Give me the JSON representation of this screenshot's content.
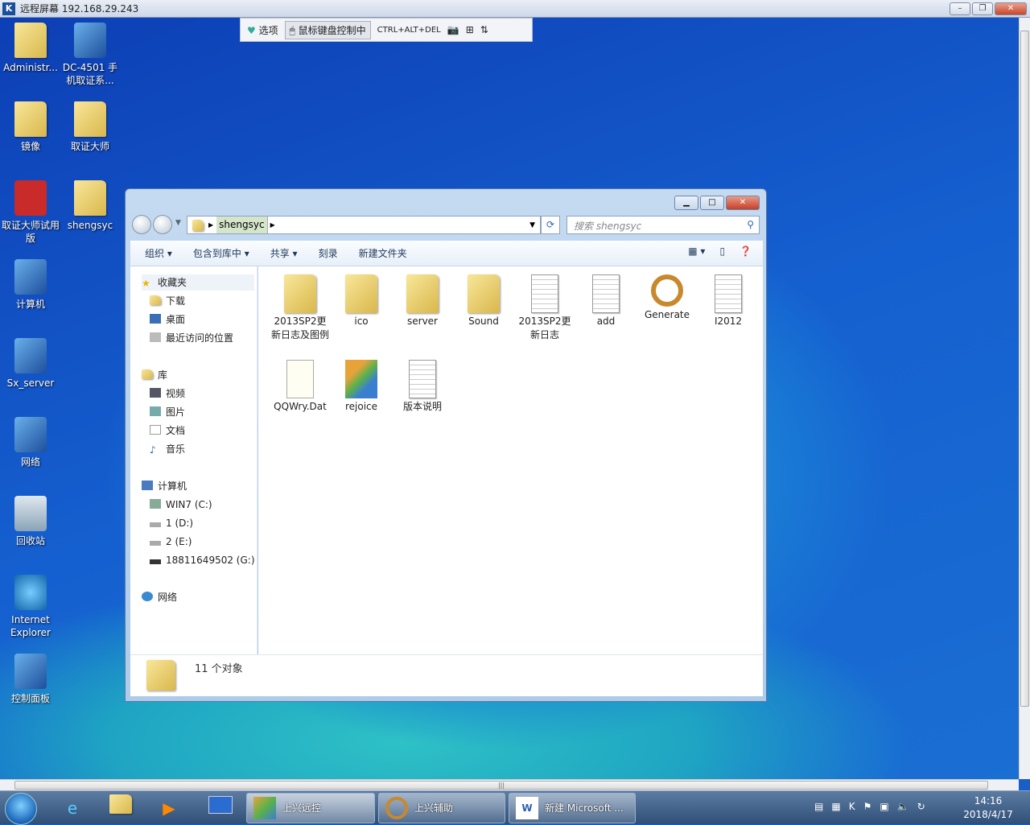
{
  "host": {
    "title": "远程屏幕 192.168.29.243"
  },
  "remote_toolbar": {
    "options": "选项",
    "control": "鼠标键盘控制中",
    "cad": "CTRL+ALT+DEL"
  },
  "desktop_icons": [
    {
      "label": "Administr...",
      "icon": "user-folder"
    },
    {
      "label": "DC-4501 手机取证系...",
      "icon": "app-shortcut"
    },
    {
      "label": "镜像",
      "icon": "folder"
    },
    {
      "label": "取证大师",
      "icon": "folder"
    },
    {
      "label": "取证大师试用版",
      "icon": "app-shortcut"
    },
    {
      "label": "shengsyc",
      "icon": "folder"
    },
    {
      "label": "计算机",
      "icon": "computer"
    },
    {
      "label": "Sx_server",
      "icon": "server"
    },
    {
      "label": "网络",
      "icon": "network"
    },
    {
      "label": "回收站",
      "icon": "recycle-bin"
    },
    {
      "label": "Internet Explorer",
      "icon": "ie"
    },
    {
      "label": "控制面板",
      "icon": "control-panel"
    }
  ],
  "explorer": {
    "address": "shengsyc",
    "search_placeholder": "搜索 shengsyc",
    "commands": [
      "组织",
      "包含到库中",
      "共享",
      "刻录",
      "新建文件夹"
    ],
    "sidebar": {
      "favorites": "收藏夹",
      "fav_items": [
        "下载",
        "桌面",
        "最近访问的位置"
      ],
      "libraries": "库",
      "lib_items": [
        "视频",
        "图片",
        "文档",
        "音乐"
      ],
      "computer": "计算机",
      "drives": [
        "WIN7 (C:)",
        "1 (D:)",
        "2 (E:)",
        "18811649502 (G:)"
      ],
      "network": "网络"
    },
    "files": [
      {
        "name": "2013SP2更新日志及图例",
        "type": "folder"
      },
      {
        "name": "ico",
        "type": "folder"
      },
      {
        "name": "server",
        "type": "folder"
      },
      {
        "name": "Sound",
        "type": "folder"
      },
      {
        "name": "2013SP2更新日志",
        "type": "document"
      },
      {
        "name": "add",
        "type": "document"
      },
      {
        "name": "Generate",
        "type": "rope-app"
      },
      {
        "name": "I2012",
        "type": "settings-file"
      },
      {
        "name": "QQWry.Dat",
        "type": "file"
      },
      {
        "name": "rejoice",
        "type": "app"
      },
      {
        "name": "版本说明",
        "type": "document"
      }
    ],
    "status": "11 个对象"
  },
  "taskbar": {
    "buttons": [
      "上兴远控",
      "上兴辅助",
      "新建 Microsoft ..."
    ],
    "time": "14:16",
    "date": "2018/4/17"
  }
}
